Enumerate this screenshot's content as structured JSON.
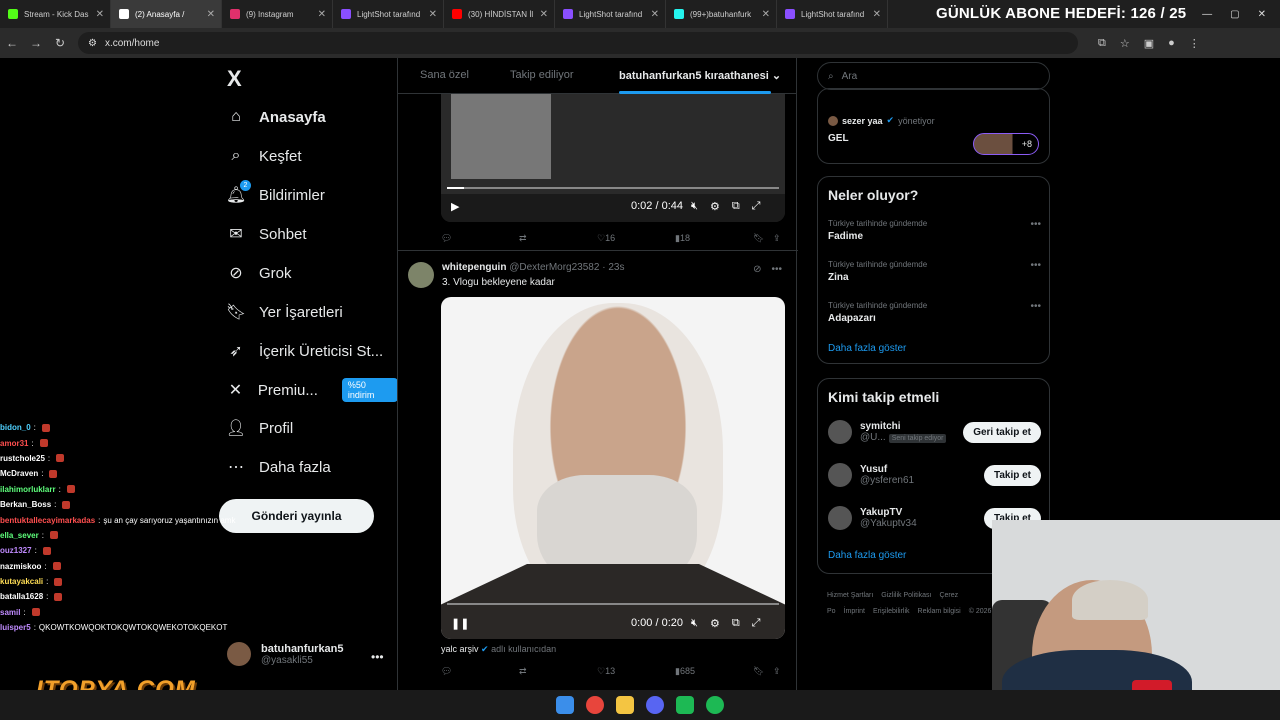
{
  "browser": {
    "tabs": [
      {
        "label": "Stream - Kick Das",
        "color": "#53fc18",
        "active": false
      },
      {
        "label": "(2) Anasayfa /",
        "color": "#ffffff",
        "active": true
      },
      {
        "label": "(9) Instagram",
        "color": "#e1306c",
        "active": false
      },
      {
        "label": "LightShot tarafınd",
        "color": "#8a4fff",
        "active": false
      },
      {
        "label": "(30) HİNDİSTAN İl",
        "color": "#ff0000",
        "active": false
      },
      {
        "label": "LightShot tarafınd",
        "color": "#8a4fff",
        "active": false
      },
      {
        "label": "(99+)batuhanfurk",
        "color": "#25f4ee",
        "active": false
      },
      {
        "label": "LightShot tarafınd",
        "color": "#8a4fff",
        "active": false
      }
    ],
    "url": "x.com/home",
    "overlay_goal": "GÜNLÜK ABONE HEDEFİ: 126 / 25"
  },
  "nav": {
    "logo": "X",
    "items": [
      {
        "label": "Anasayfa",
        "icon": "home-icon",
        "glyph": "⌂"
      },
      {
        "label": "Keşfet",
        "icon": "search-icon",
        "glyph": "⌕"
      },
      {
        "label": "Bildirimler",
        "icon": "bell-icon",
        "glyph": "🔔︎"
      },
      {
        "label": "Sohbet",
        "icon": "mail-icon",
        "glyph": "✉"
      },
      {
        "label": "Grok",
        "icon": "grok-icon",
        "glyph": "⊘"
      },
      {
        "label": "Yer İşaretleri",
        "icon": "bookmark-icon",
        "glyph": "🔖︎"
      },
      {
        "label": "İçerik Üreticisi St...",
        "icon": "rocket-icon",
        "glyph": "➶"
      },
      {
        "label": "Premiu...",
        "icon": "x-premium-icon",
        "glyph": "✕"
      },
      {
        "label": "Profil",
        "icon": "user-icon",
        "glyph": "👤︎"
      },
      {
        "label": "Daha fazla",
        "icon": "more-circle-icon",
        "glyph": "⋯"
      }
    ],
    "notification_badge": "2",
    "premium_promo": "%50 indirim",
    "post_button": "Gönderi yayınla",
    "profile_name": "batuhanfurkan5",
    "profile_handle": "@yasakli55"
  },
  "timeline": {
    "tabs": [
      "Sana özel",
      "Takip ediliyor",
      "batuhanfurkan5 kıraathanesi"
    ],
    "video1": {
      "time": "0:02 / 0:44",
      "progress": 0.05
    },
    "tweet1_actions": {
      "likes": "16",
      "views": "18"
    },
    "tweet2": {
      "author": "whitepenguin",
      "handle": "@DexterMorg23582 · 23s",
      "text": "3. Vlogu bekleyene kadar",
      "video_time": "0:00 / 0:20",
      "progress": 0.0,
      "attribution_name": "yalc arşiv",
      "attribution_suffix": "adlı kullanıcıdan",
      "likes": "13",
      "views": "685"
    }
  },
  "sidebar": {
    "search_placeholder": "Ara",
    "community": {
      "user": "sezer yaa",
      "role": "yönetiyor",
      "title": "GEL",
      "members_more": "+8"
    },
    "trends_title": "Neler oluyor?",
    "trends": [
      {
        "context": "Türkiye tarihinde gündemde",
        "name": "Fadime"
      },
      {
        "context": "Türkiye tarihinde gündemde",
        "name": "Zina"
      },
      {
        "context": "Türkiye tarihinde gündemde",
        "name": "Adapazarı"
      }
    ],
    "show_more": "Daha fazla göster",
    "follow_title": "Kimi takip etmeli",
    "follow": [
      {
        "name": "symitchi",
        "handle": "@U...",
        "badge": "Seni takip ediyor",
        "button": "Geri takip et"
      },
      {
        "name": "Yusuf",
        "handle": "@ysferen61",
        "badge": "",
        "button": "Takip et"
      },
      {
        "name": "YakupTV",
        "handle": "@Yakuptv34",
        "badge": "",
        "button": "Takip et"
      }
    ],
    "footer": [
      "Hizmet Şartları",
      "Gizlilik Politikası",
      "Çerez Po",
      "İmprint",
      "Erişilebilirlik",
      "Reklam bilgisi",
      "© 2026 X Corp."
    ]
  },
  "chat": [
    {
      "user": "bidon_0",
      "msg": "",
      "color": "#4fd1ff"
    },
    {
      "user": "amor31",
      "msg": "",
      "color": "#ff4f4f"
    },
    {
      "user": "rustchole25",
      "msg": "",
      "color": "#ffffff"
    },
    {
      "user": "McDraven",
      "msg": "",
      "color": "#ffffff"
    },
    {
      "user": "ilahimorluklarr",
      "msg": "",
      "color": "#5eff7c"
    },
    {
      "user": "Berkan_Boss",
      "msg": "",
      "color": "#ffffff"
    },
    {
      "user": "bentuktallecayimarkadas",
      "msg": "şu an çay sarıyoruz yaşantınızın amk",
      "color": "#ff4f4f"
    },
    {
      "user": "ella_sever",
      "msg": "",
      "color": "#5eff7c"
    },
    {
      "user": "ouz1327",
      "msg": "",
      "color": "#c08bff"
    },
    {
      "user": "nazmiskoo",
      "msg": "",
      "color": "#ffffff"
    },
    {
      "user": "kutayakcali",
      "msg": "",
      "color": "#ffdd55"
    },
    {
      "user": "batalla1628",
      "msg": "",
      "color": "#ffffff"
    },
    {
      "user": "samil",
      "msg": "",
      "color": "#c08bff"
    },
    {
      "user": "luisper5",
      "msg": "QKOWTKOWQOKTOKQWTOKQWEKOTOKQEKOT",
      "color": "#c08bff"
    }
  ],
  "sponsor": "ITOPYA.COM",
  "colors": {
    "accent": "#1d9bf0",
    "bg": "#000000",
    "border": "#2f3336"
  }
}
